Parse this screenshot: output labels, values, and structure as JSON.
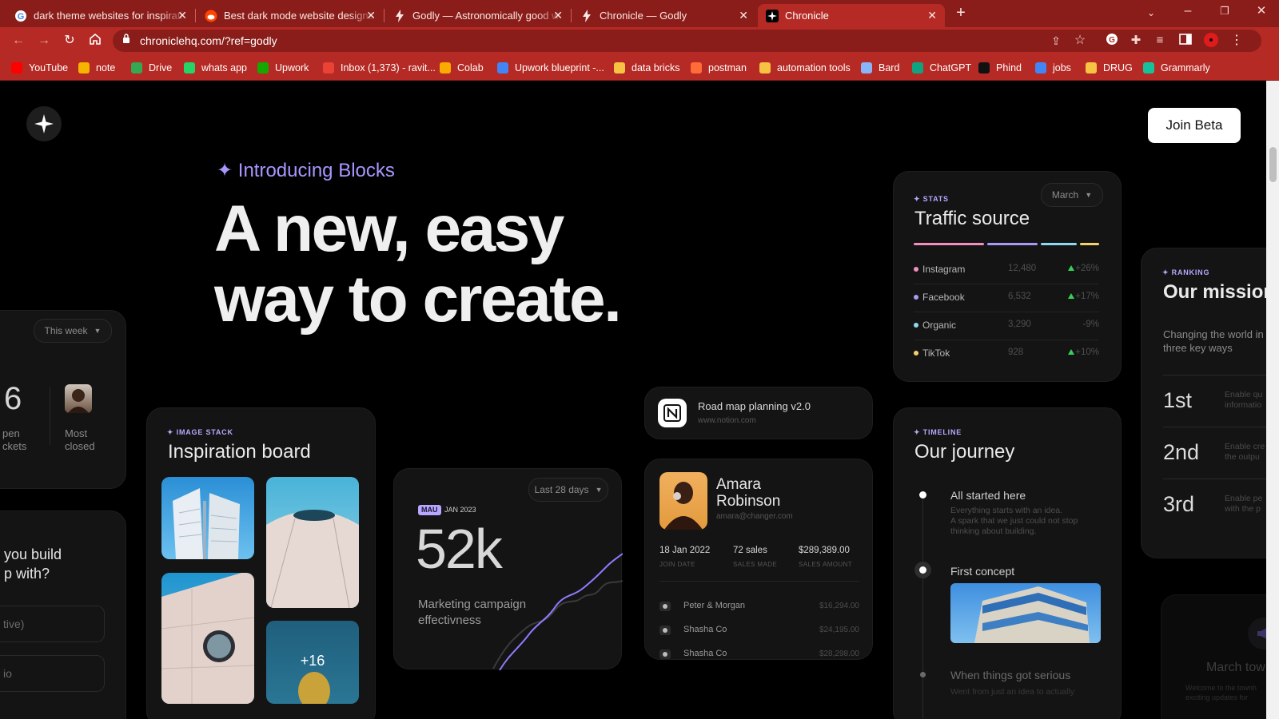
{
  "browser": {
    "tabs": [
      {
        "title": "dark theme websites for inspirati"
      },
      {
        "title": "Best dark mode website designs?"
      },
      {
        "title": "Godly — Astronomically good w"
      },
      {
        "title": "Chronicle — Godly"
      },
      {
        "title": "Chronicle"
      }
    ],
    "url": "chroniclehq.com/?ref=godly",
    "bookmarks": [
      {
        "label": "YouTube",
        "color": "#ff0000"
      },
      {
        "label": "note",
        "color": "#f4b400"
      },
      {
        "label": "Drive",
        "color": "#34a853"
      },
      {
        "label": "whats app",
        "color": "#25d366"
      },
      {
        "label": "Upwork",
        "color": "#14a800"
      },
      {
        "label": "Inbox (1,373) - ravit...",
        "color": "#ea4335"
      },
      {
        "label": "Colab",
        "color": "#f9ab00"
      },
      {
        "label": "Upwork blueprint -...",
        "color": "#4285f4"
      },
      {
        "label": "data bricks",
        "color": "#f6c343"
      },
      {
        "label": "postman",
        "color": "#ff6c37"
      },
      {
        "label": "automation tools",
        "color": "#f6c343"
      },
      {
        "label": "Bard",
        "color": "#8ab4f8"
      },
      {
        "label": "ChatGPT",
        "color": "#10a37f"
      },
      {
        "label": "Phind",
        "color": "#111111"
      },
      {
        "label": "jobs",
        "color": "#4285f4"
      },
      {
        "label": "DRUG",
        "color": "#f6c343"
      },
      {
        "label": "Grammarly",
        "color": "#15c39a"
      }
    ]
  },
  "site": {
    "join_button": "Join Beta",
    "eyebrow": "✦ Introducing Blocks",
    "headline_line1": "A new, easy",
    "headline_line2": "way to create."
  },
  "tickets_card": {
    "filter": "This week",
    "big_number": "6",
    "open_label_1": "pen",
    "open_label_2": "ckets",
    "most_label_1": "Most",
    "most_label_2": "closed"
  },
  "question_card": {
    "line1": "you build",
    "line2": "p with?",
    "field1": "tive)",
    "field2": "io"
  },
  "inspiration": {
    "tag": "✦ IMAGE STACK",
    "title": "Inspiration board",
    "more_count": "+16"
  },
  "mau": {
    "filter": "Last 28 days",
    "badge": "MAU",
    "date": "JAN 2023",
    "value": "52k",
    "caption_1": "Marketing campaign",
    "caption_2": "effectivness"
  },
  "roadmap": {
    "title": "Road map planning v2.0",
    "url": "www.notion.com"
  },
  "profile": {
    "first_name": "Amara",
    "last_name": "Robinson",
    "email": "amara@changer.com",
    "stats": [
      {
        "value": "18 Jan 2022",
        "label": "JOIN DATE"
      },
      {
        "value": "72 sales",
        "label": "SALES MADE"
      },
      {
        "value": "$289,389.00",
        "label": "SALES AMOUNT"
      }
    ],
    "deals": [
      {
        "name": "Peter & Morgan",
        "amount": "$16,294.00"
      },
      {
        "name": "Shasha Co",
        "amount": "$24,195.00"
      },
      {
        "name": "Shasha Co",
        "amount": "$28,298.00"
      }
    ]
  },
  "traffic": {
    "tag": "✦ STATS",
    "title": "Traffic source",
    "month": "March",
    "rows": [
      {
        "name": "Instagram",
        "count": "12,480",
        "change": "+26%",
        "color": "#f28fc0"
      },
      {
        "name": "Facebook",
        "count": "6,532",
        "change": "+17%",
        "color": "#a79cf5"
      },
      {
        "name": "Organic",
        "count": "3,290",
        "change": "-9%",
        "color": "#8fd8f2"
      },
      {
        "name": "TikTok",
        "count": "928",
        "change": "+10%",
        "color": "#f2d36b"
      }
    ]
  },
  "journey": {
    "tag": "✦ TIMELINE",
    "title": "Our journey",
    "step1_title": "All started here",
    "step1_line1": "Everything starts with an idea.",
    "step1_line2": "A spark that we just could not stop",
    "step1_line3": "thinking about building.",
    "step2_title": "First concept",
    "step3_title": "When things got serious",
    "step3_text": "Went from just an idea to actually"
  },
  "mission": {
    "tag": "✦ RANKING",
    "title": "Our mission",
    "sub_1": "Changing the world in",
    "sub_2": "three key ways",
    "items": [
      {
        "rank": "1st",
        "line1": "Enable qu",
        "line2": "informatio"
      },
      {
        "rank": "2nd",
        "line1": "Enable cre",
        "line2": "the outpu"
      },
      {
        "rank": "3rd",
        "line1": "Enable pe",
        "line2": "with the p"
      }
    ]
  },
  "march_card": {
    "title": "March tow",
    "line1": "Welcome to the townh",
    "line2": "exciting updates for"
  }
}
